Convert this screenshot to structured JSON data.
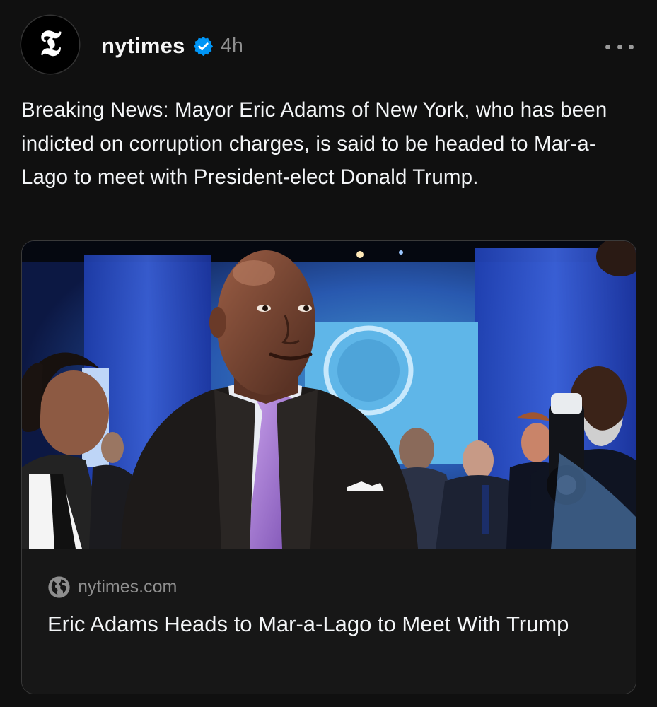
{
  "post": {
    "avatar_glyph": "𝕿",
    "username": "nytimes",
    "verified_icon": "verified-badge-icon",
    "timestamp": "4h",
    "more_icon": "more-options-icon",
    "caption": "Breaking News: Mayor Eric Adams of New York, who has been indicted on corruption charges, is said to be headed to Mar-a-Lago to meet with President-elect Donald Trump."
  },
  "link_card": {
    "image_description_icon": "news-photo",
    "domain_icon": "globe-icon",
    "domain": "nytimes.com",
    "headline": "Eric Adams Heads to Mar-a-Lago to Meet With Trump"
  },
  "colors": {
    "background": "#101010",
    "text": "#f3f5f7",
    "secondary_text": "#8e8e8e",
    "verified_blue": "#0095f6",
    "card_border": "#3a3a3a"
  }
}
